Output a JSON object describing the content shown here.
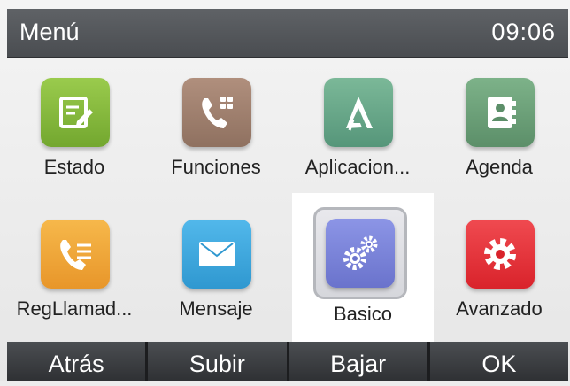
{
  "header": {
    "title": "Menú",
    "time": "09:06"
  },
  "menu": {
    "items": [
      {
        "label": "Estado",
        "icon": "status-icon",
        "color": "#86bb3e"
      },
      {
        "label": "Funciones",
        "icon": "phone-features-icon",
        "color": "#a08270"
      },
      {
        "label": "Aplicacion...",
        "icon": "applications-icon",
        "color": "#6aa98a"
      },
      {
        "label": "Agenda",
        "icon": "contacts-book-icon",
        "color": "#6fa07b"
      },
      {
        "label": "RegLlamad...",
        "icon": "call-log-icon",
        "color": "#f2a93a"
      },
      {
        "label": "Mensaje",
        "icon": "envelope-icon",
        "color": "#3fa9df"
      },
      {
        "label": "Basico",
        "icon": "gears-icon",
        "color": "#7c85dc",
        "selected": true
      },
      {
        "label": "Avanzado",
        "icon": "gear-icon",
        "color": "#e8343c"
      }
    ]
  },
  "softkeys": {
    "back": "Atrás",
    "up": "Subir",
    "down": "Bajar",
    "ok": "OK"
  }
}
